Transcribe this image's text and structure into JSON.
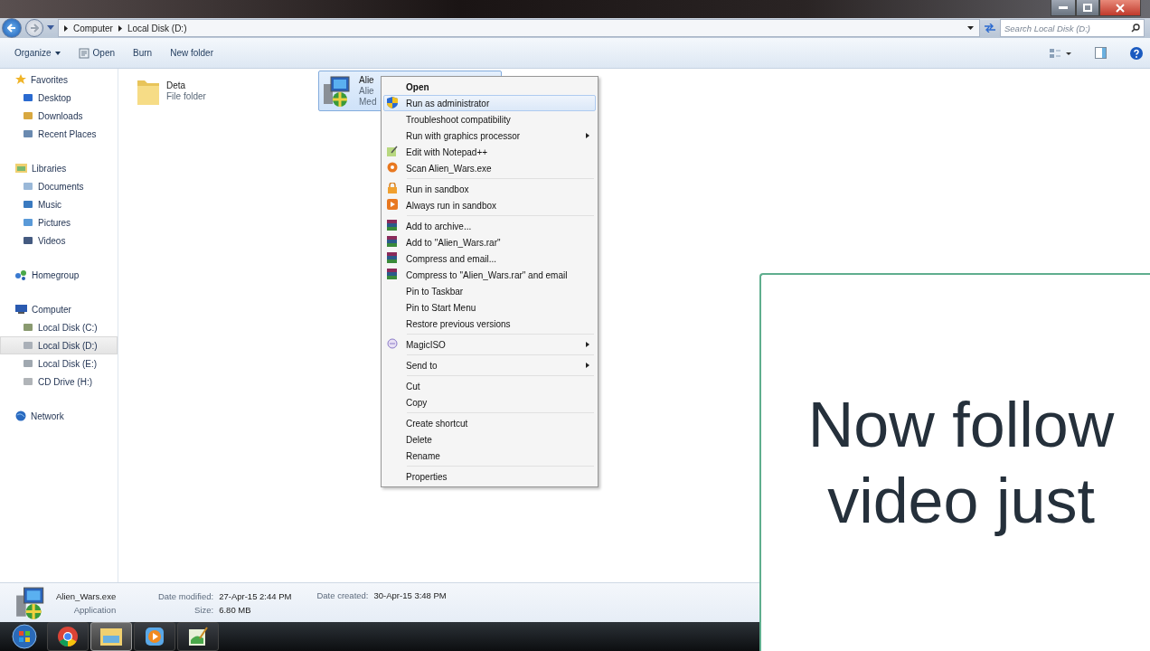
{
  "address_bar": {
    "breadcrumbs": [
      "Computer",
      "Local Disk (D:)"
    ]
  },
  "search": {
    "placeholder": "Search Local Disk (D:)"
  },
  "toolbar": {
    "buttons": [
      {
        "label": "Organize",
        "dropdown": true
      },
      {
        "label": "Open",
        "dropdown": false
      },
      {
        "label": "Burn",
        "dropdown": false
      },
      {
        "label": "New folder",
        "dropdown": false
      }
    ]
  },
  "sidebar": {
    "groups": [
      {
        "label": "Favorites",
        "children": [
          {
            "label": "Desktop",
            "selected": false
          },
          {
            "label": "Downloads",
            "selected": false
          },
          {
            "label": "Recent Places",
            "selected": false
          }
        ]
      },
      {
        "label": "Libraries",
        "children": [
          {
            "label": "Documents",
            "selected": false
          },
          {
            "label": "Music",
            "selected": false
          },
          {
            "label": "Pictures",
            "selected": false
          },
          {
            "label": "Videos",
            "selected": false
          }
        ]
      },
      {
        "label": "Homegroup"
      },
      {
        "label": "Computer",
        "children": [
          {
            "label": "Local Disk (C:)",
            "selected": false
          },
          {
            "label": "Local Disk (D:)",
            "selected": true
          },
          {
            "label": "Local Disk (E:)",
            "selected": false
          },
          {
            "label": "CD Drive (H:)",
            "selected": false
          }
        ]
      },
      {
        "label": "Network"
      }
    ]
  },
  "files": [
    {
      "kind": "folder",
      "name": "Deta",
      "type": "File folder",
      "selected": false
    },
    {
      "kind": "program",
      "name": "Alie",
      "type": "Alie",
      "extra": "Med",
      "selected": true
    }
  ],
  "context_menu": {
    "items": [
      {
        "kind": "item",
        "label": "Open",
        "bold": true,
        "selected": false
      },
      {
        "kind": "item",
        "label": "Run as administrator",
        "bold": false,
        "selected": true
      },
      {
        "kind": "item",
        "label": "Troubleshoot compatibility",
        "bold": false,
        "selected": false
      },
      {
        "kind": "submenu",
        "label": "Run with graphics processor",
        "bold": false,
        "selected": false
      },
      {
        "kind": "item",
        "label": "Edit with Notepad++",
        "bold": false,
        "selected": false
      },
      {
        "kind": "item",
        "label": "Scan Alien_Wars.exe",
        "bold": false,
        "selected": false
      },
      {
        "kind": "separator"
      },
      {
        "kind": "item",
        "label": "Run in sandbox",
        "bold": false,
        "selected": false
      },
      {
        "kind": "item",
        "label": "Always run in sandbox",
        "bold": false,
        "selected": false
      },
      {
        "kind": "separator"
      },
      {
        "kind": "item",
        "label": "Add to archive...",
        "bold": false,
        "selected": false
      },
      {
        "kind": "item",
        "label": "Add to \"Alien_Wars.rar\"",
        "bold": false,
        "selected": false
      },
      {
        "kind": "item",
        "label": "Compress and email...",
        "bold": false,
        "selected": false
      },
      {
        "kind": "item",
        "label": "Compress to \"Alien_Wars.rar\" and email",
        "bold": false,
        "selected": false
      },
      {
        "kind": "item",
        "label": "Pin to Taskbar",
        "bold": false,
        "selected": false
      },
      {
        "kind": "item",
        "label": "Pin to Start Menu",
        "bold": false,
        "selected": false
      },
      {
        "kind": "item",
        "label": "Restore previous versions",
        "bold": false,
        "selected": false
      },
      {
        "kind": "separator"
      },
      {
        "kind": "submenu",
        "label": "MagicISO",
        "bold": false,
        "selected": false
      },
      {
        "kind": "separator"
      },
      {
        "kind": "submenu",
        "label": "Send to",
        "bold": false,
        "selected": false
      },
      {
        "kind": "separator"
      },
      {
        "kind": "item",
        "label": "Cut",
        "bold": false,
        "selected": false
      },
      {
        "kind": "item",
        "label": "Copy",
        "bold": false,
        "selected": false
      },
      {
        "kind": "separator"
      },
      {
        "kind": "item",
        "label": "Create shortcut",
        "bold": false,
        "selected": false
      },
      {
        "kind": "item",
        "label": "Delete",
        "bold": false,
        "selected": false
      },
      {
        "kind": "item",
        "label": "Rename",
        "bold": false,
        "selected": false
      },
      {
        "kind": "separator"
      },
      {
        "kind": "item",
        "label": "Properties",
        "bold": false,
        "selected": false
      }
    ]
  },
  "details": {
    "name": "Alien_Wars.exe",
    "type": "Application",
    "fields": [
      {
        "label": "Date modified:",
        "value": "27-Apr-15 2:44 PM"
      },
      {
        "label": "Size:",
        "value": "6.80 MB"
      },
      {
        "label": "Date created:",
        "value": "30-Apr-15 3:48 PM"
      }
    ]
  },
  "taskbar": {
    "buttons": [
      {
        "kind": "start",
        "selected": false
      },
      {
        "kind": "browser",
        "selected": false
      },
      {
        "kind": "explorer",
        "selected": true
      },
      {
        "kind": "media",
        "selected": false
      },
      {
        "kind": "editor",
        "selected": false
      }
    ]
  },
  "overlay": {
    "lines": [
      "Now follow",
      "video just"
    ]
  }
}
